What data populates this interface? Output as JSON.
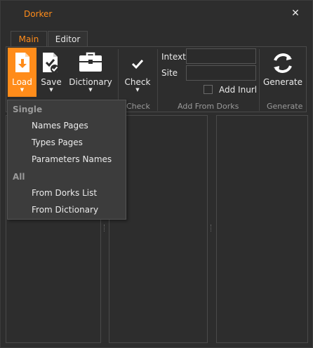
{
  "window": {
    "title": "Dorker"
  },
  "tabs": [
    {
      "label": "Main"
    },
    {
      "label": "Editor"
    }
  ],
  "ribbon": {
    "load": {
      "label": "Load"
    },
    "save": {
      "label": "Save"
    },
    "dictionary": {
      "label": "Dictionary"
    },
    "check": {
      "label": "Check"
    },
    "generate": {
      "label": "Generate"
    },
    "groups": {
      "check": "Check",
      "add_from_dorks": "Add From Dorks",
      "generate": "Generate"
    },
    "intext": {
      "label": "Intext",
      "value": ""
    },
    "site": {
      "label": "Site",
      "value": ""
    },
    "add_inurl": {
      "label": "Add Inurl",
      "checked": false
    }
  },
  "load_menu": {
    "sections": [
      {
        "header": "Single",
        "items": [
          "Names Pages",
          "Types Pages",
          "Parameters Names"
        ]
      },
      {
        "header": "All",
        "items": [
          "From Dorks List",
          "From Dictionary"
        ]
      }
    ]
  },
  "colors": {
    "accent": "#ff8c1a",
    "background": "#2d2d2d",
    "menu": "#3c3c3c"
  },
  "icons": [
    "close-icon",
    "download-file-icon",
    "save-check-icon",
    "briefcase-icon",
    "checkmark-icon",
    "refresh-icon",
    "dropdown-arrow-icon"
  ]
}
